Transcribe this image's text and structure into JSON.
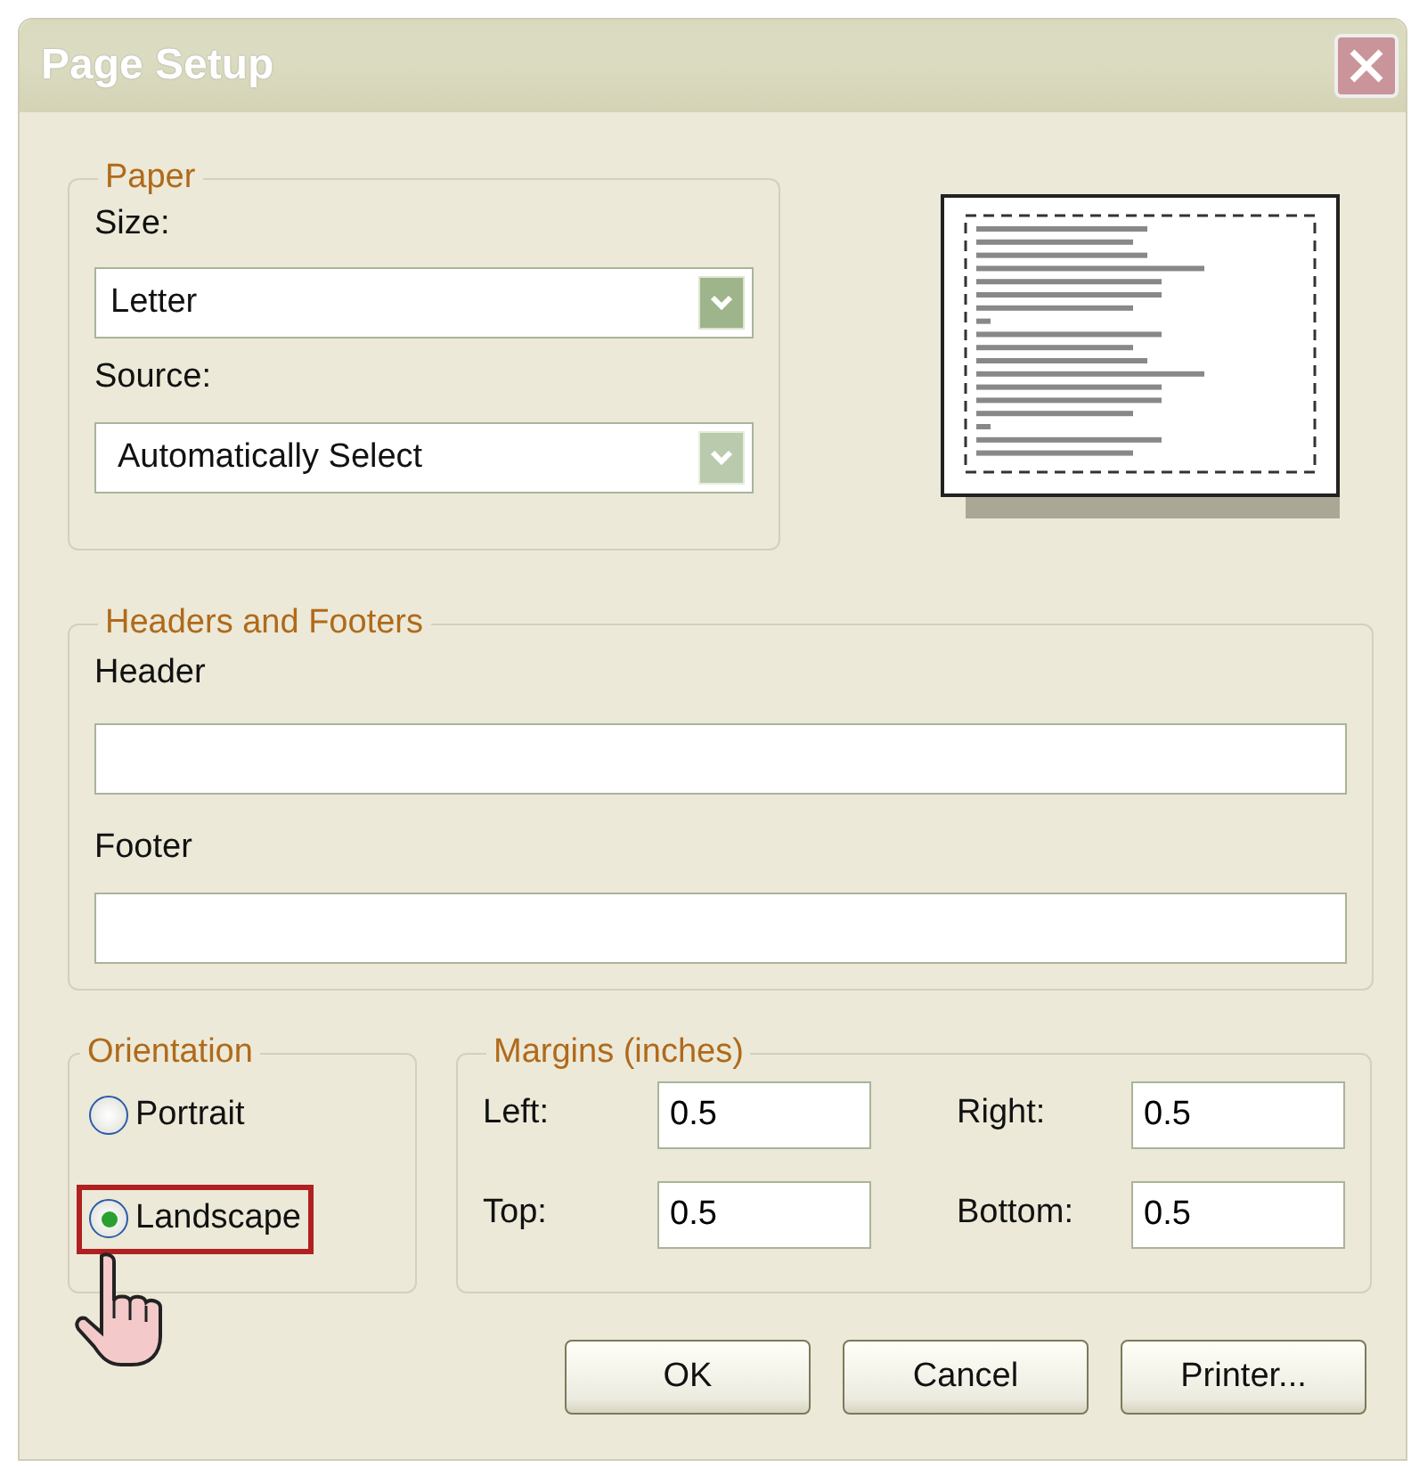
{
  "window": {
    "title": "Page Setup"
  },
  "paper": {
    "legend": "Paper",
    "size_label": "Size:",
    "size_value": "Letter",
    "source_label": "Source:",
    "source_value": "Automatically Select"
  },
  "headers_footers": {
    "legend": "Headers and Footers",
    "header_label": "Header",
    "footer_label": "Footer"
  },
  "orientation": {
    "legend": "Orientation",
    "options": [
      {
        "label": "Portrait",
        "selected": false,
        "highlighted": false
      },
      {
        "label": "Landscape",
        "selected": true,
        "highlighted": true
      }
    ]
  },
  "margins": {
    "legend": "Margins (inches)",
    "fields": [
      {
        "label": "Left:",
        "value": "0.5"
      },
      {
        "label": "Right:",
        "value": "0.5"
      },
      {
        "label": "Top:",
        "value": "0.5"
      },
      {
        "label": "Bottom:",
        "value": "0.5"
      }
    ]
  },
  "buttons": [
    "OK",
    "Cancel",
    "Printer..."
  ]
}
